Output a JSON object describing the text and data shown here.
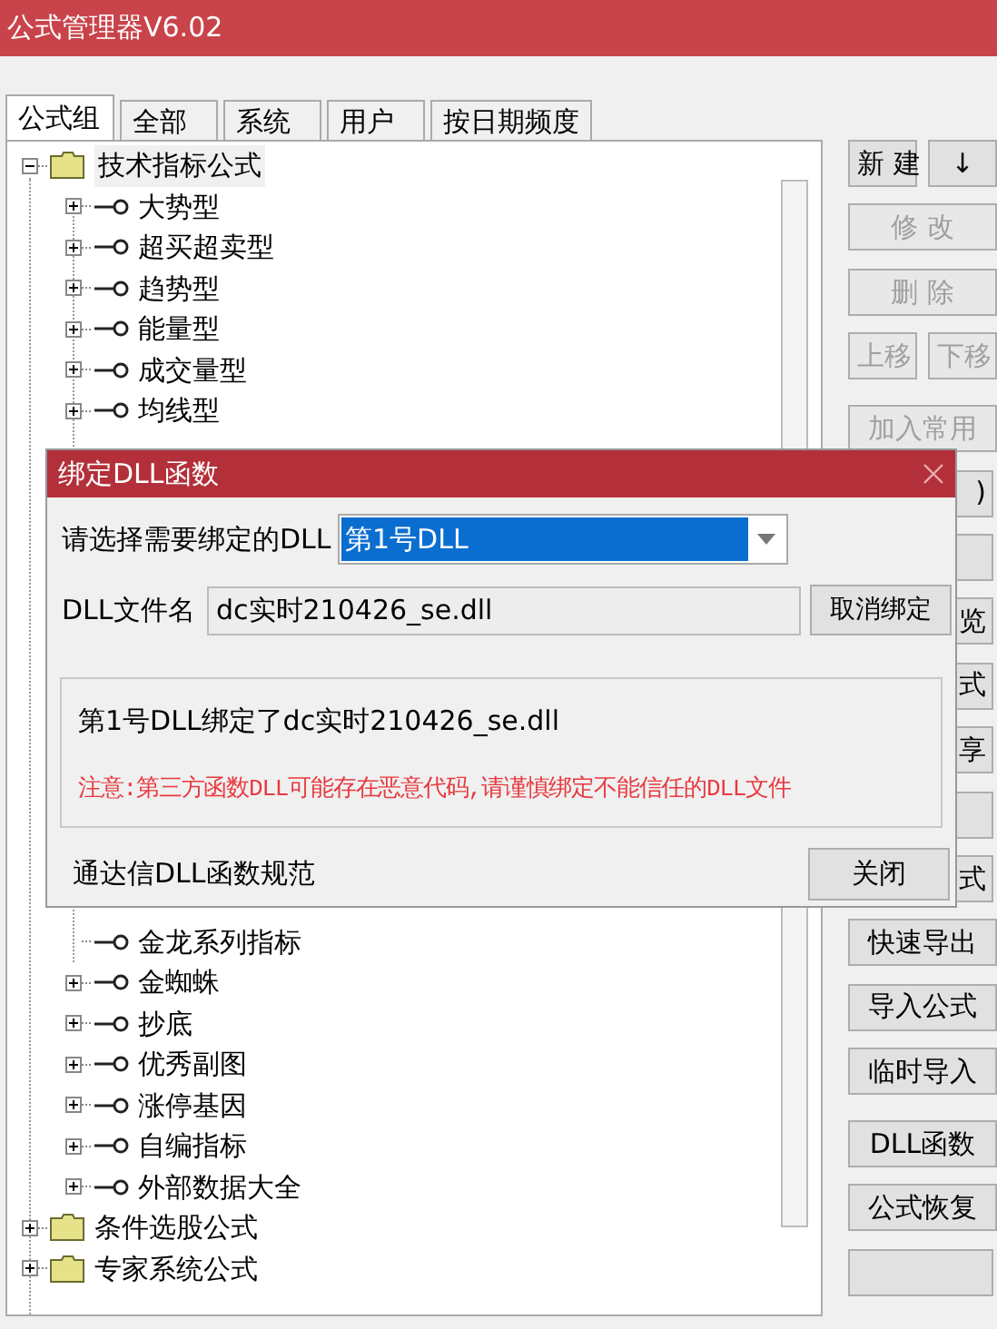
{
  "window": {
    "title": "公式管理器V6.02"
  },
  "tabs": [
    {
      "label": "公式组",
      "selected": true
    },
    {
      "label": "全部",
      "selected": false
    },
    {
      "label": "系统",
      "selected": false
    },
    {
      "label": "用户",
      "selected": false
    },
    {
      "label": "按日期频度",
      "selected": false
    }
  ],
  "tree": {
    "items_top": [
      {
        "label": "技术指标公式",
        "kind": "folder",
        "expanded": true,
        "children": [
          {
            "label": "大势型",
            "kind": "formula",
            "expanded": false
          },
          {
            "label": "超买超卖型",
            "kind": "formula",
            "expanded": false
          },
          {
            "label": "趋势型",
            "kind": "formula",
            "expanded": false
          },
          {
            "label": "能量型",
            "kind": "formula",
            "expanded": false
          },
          {
            "label": "成交量型",
            "kind": "formula",
            "expanded": false
          },
          {
            "label": "均线型",
            "kind": "formula",
            "expanded": false
          }
        ]
      }
    ],
    "items_bottom": [
      {
        "label": "金龙系列指标",
        "kind": "leaf"
      },
      {
        "label": "金蜘蛛",
        "kind": "formula",
        "expanded": false
      },
      {
        "label": "抄底",
        "kind": "formula",
        "expanded": false
      },
      {
        "label": "优秀副图",
        "kind": "formula",
        "expanded": false
      },
      {
        "label": "涨停基因",
        "kind": "formula",
        "expanded": false
      },
      {
        "label": "自编指标",
        "kind": "formula",
        "expanded": false
      },
      {
        "label": "外部数据大全",
        "kind": "formula",
        "expanded": false
      }
    ],
    "folders_bottom": [
      {
        "label": "条件选股公式",
        "kind": "folder",
        "expanded": false
      },
      {
        "label": "专家系统公式",
        "kind": "folder",
        "expanded": false
      }
    ]
  },
  "button_groups": [
    [
      [
        {
          "label": "新 建",
          "kind": "normal",
          "disabled": false
        },
        {
          "label": "↓",
          "kind": "normal",
          "disabled": false
        }
      ],
      [
        {
          "label": "修 改",
          "kind": "normal",
          "disabled": true
        }
      ],
      [
        {
          "label": "删 除",
          "kind": "normal",
          "disabled": true
        }
      ],
      [
        {
          "label": "上移",
          "kind": "normal",
          "disabled": true
        },
        {
          "label": "下移",
          "kind": "normal",
          "disabled": true
        }
      ]
    ],
    [
      [
        {
          "label": "加入常用",
          "kind": "normal",
          "disabled": true
        }
      ],
      [
        {
          "label": ")",
          "kind": "covered"
        }
      ],
      [
        {
          "kind": "blank"
        }
      ],
      [
        {
          "label": "览",
          "kind": "covered"
        }
      ],
      [
        {
          "label": "式",
          "kind": "covered"
        }
      ],
      [
        {
          "label": "享",
          "kind": "covered"
        }
      ],
      [
        {
          "kind": "blank"
        }
      ],
      [
        {
          "label": "式",
          "kind": "covered"
        }
      ],
      [
        {
          "label": "快速导出",
          "kind": "normal",
          "disabled": false
        }
      ],
      [
        {
          "label": "导入公式",
          "kind": "normal",
          "disabled": false
        }
      ],
      [
        {
          "label": "临时导入",
          "kind": "normal",
          "disabled": false
        }
      ]
    ],
    [
      [
        {
          "label": "DLL函数",
          "kind": "normal",
          "disabled": false
        }
      ],
      [
        {
          "label": "公式恢复",
          "kind": "normal",
          "disabled": false
        }
      ],
      [
        {
          "kind": "blank"
        }
      ]
    ]
  ],
  "dialog": {
    "title": "绑定DLL函数",
    "select_label": "请选择需要绑定的DLL",
    "select_value": "第1号DLL",
    "file_label": "DLL文件名",
    "file_value": "dc实时210426_se.dll",
    "unbind_button": "取消绑定",
    "info": "第1号DLL绑定了dc实时210426_se.dll",
    "warning": "注意:第三方函数DLL可能存在恶意代码,请谨慎绑定不能信任的DLL文件",
    "spec_link": "通达信DLL函数规范",
    "close_button": "关闭"
  }
}
